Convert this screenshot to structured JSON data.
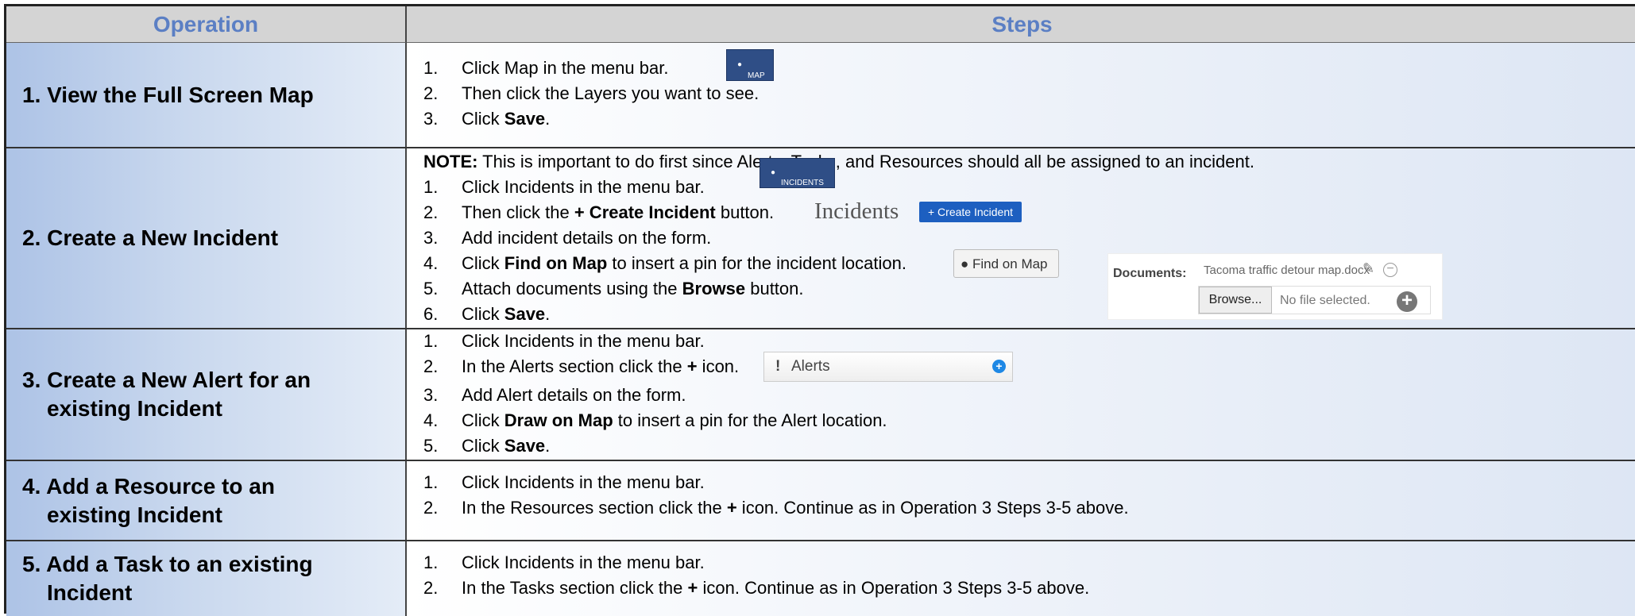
{
  "header": {
    "operation": "Operation",
    "steps": "Steps"
  },
  "rows": [
    {
      "op_line1": "1. View the Full Screen Map",
      "steps": [
        {
          "n": "1.",
          "t": "Click Map in the menu bar."
        },
        {
          "n": "2.",
          "t": "Then click the Layers you want to see."
        },
        {
          "n": "3.",
          "t_pre": "Click ",
          "t_bold": "Save",
          "t_post": "."
        }
      ],
      "map_button": "MAP"
    },
    {
      "op_line1": "2. Create a New Incident",
      "note_bold": "NOTE:",
      "note_text": " This is important to do first since Alerts, Tasks, and Resources should all be assigned to an incident.",
      "steps": [
        {
          "n": "1.",
          "t": "Click Incidents in the menu bar."
        },
        {
          "n": "2.",
          "t_pre": "Then click the ",
          "t_bold": "+ Create Incident",
          "t_post": " button."
        },
        {
          "n": "3.",
          "t": "Add incident details on the form."
        },
        {
          "n": "4.",
          "t_pre": "Click ",
          "t_bold": "Find on Map",
          "t_post": " to insert a pin for the incident location."
        },
        {
          "n": "5.",
          "t_pre": "Attach  documents using the ",
          "t_bold": "Browse",
          "t_post": " button."
        },
        {
          "n": "6.",
          "t_pre": "Click ",
          "t_bold": "Save",
          "t_post": "."
        }
      ],
      "incidents_button": "INCIDENTS",
      "incidents_title": "Incidents",
      "create_incident_button": "+ Create Incident",
      "find_on_map_button": "Find on Map",
      "documents": {
        "label": "Documents:",
        "file": "Tacoma traffic detour map.docx",
        "browse": "Browse...",
        "no_file": "No file selected."
      }
    },
    {
      "op_line1": "3. Create a New Alert for an",
      "op_line2": "existing Incident",
      "steps": [
        {
          "n": "1.",
          "t": "Click Incidents in the menu bar."
        },
        {
          "n": "2.",
          "t_pre": "In the Alerts section click the ",
          "t_bold": "+",
          "t_post": " icon."
        },
        {
          "n": "3.",
          "t": "Add Alert details on the form."
        },
        {
          "n": "4.",
          "t_pre": "Click ",
          "t_bold": "Draw on Map",
          "t_post": " to insert a pin for the Alert location."
        },
        {
          "n": "5.",
          "t_pre": "Click ",
          "t_bold": "Save",
          "t_post": "."
        }
      ],
      "alerts_label": "Alerts"
    },
    {
      "op_line1": "4. Add a Resource to an",
      "op_line2": "existing Incident",
      "steps": [
        {
          "n": "1.",
          "t": "Click Incidents in the menu bar."
        },
        {
          "n": "2.",
          "t_pre": "In the Resources section click the ",
          "t_bold": "+",
          "t_post": " icon.  Continue as in Operation 3 Steps 3-5 above."
        }
      ]
    },
    {
      "op_line1": "5. Add a Task to an existing",
      "op_line2": "Incident",
      "steps": [
        {
          "n": "1.",
          "t": "Click Incidents in the menu bar."
        },
        {
          "n": "2.",
          "t_pre": "In the Tasks section click the ",
          "t_bold": "+",
          "t_post": " icon. Continue as in Operation 3 Steps 3-5 above."
        }
      ]
    }
  ]
}
